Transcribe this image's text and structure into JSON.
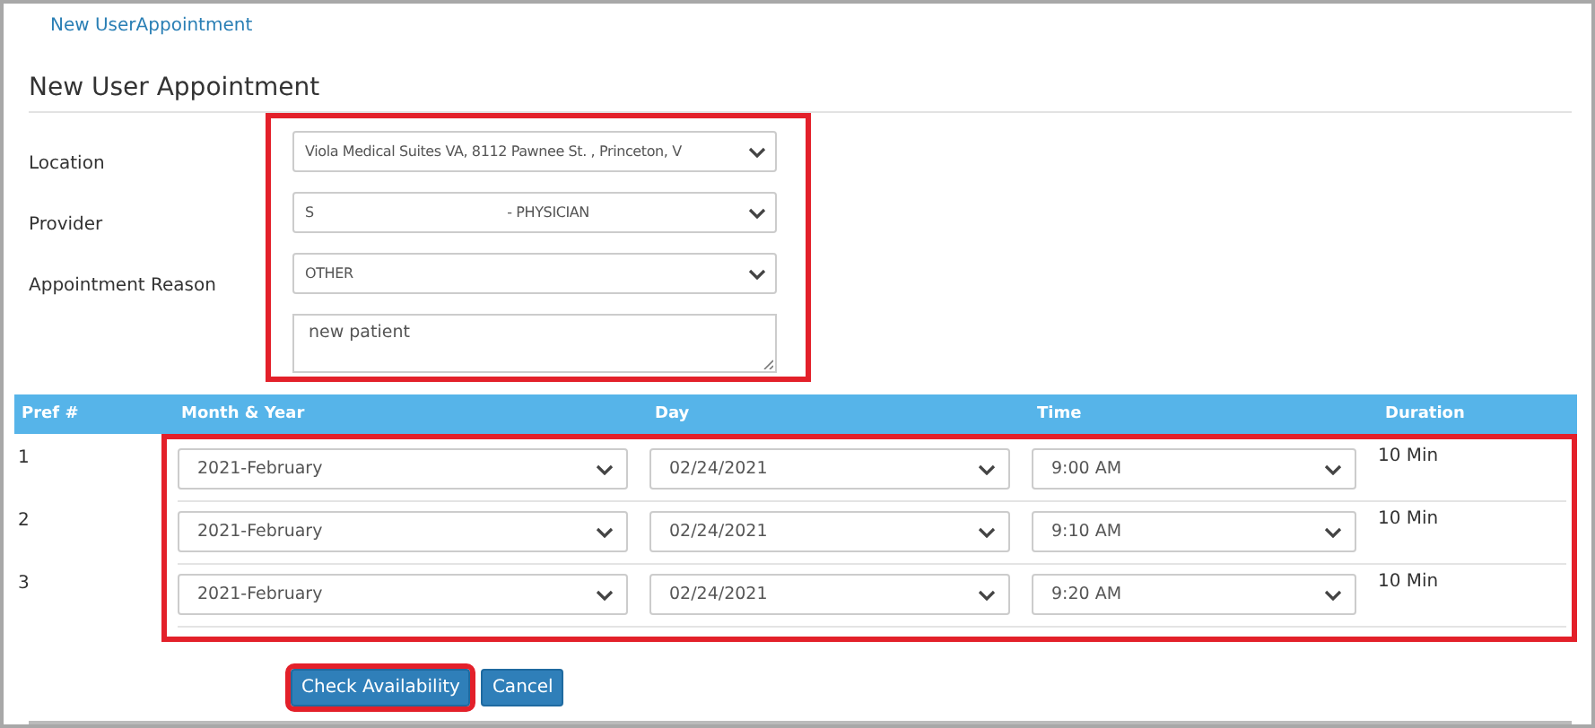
{
  "breadcrumb": "New UserAppointment",
  "title": "New User Appointment",
  "form": {
    "fields": [
      {
        "label": "Location",
        "kind": "select",
        "value": "Viola Medical Suites VA, 8112 Pawnee St. , Princeton, V"
      },
      {
        "label": "Provider",
        "kind": "select",
        "value": "S                                              - PHYSICIAN"
      },
      {
        "label": "Appointment Reason",
        "kind": "select",
        "value": "OTHER"
      },
      {
        "kind": "textarea",
        "value": "new patient"
      }
    ]
  },
  "table": {
    "columns": [
      "Pref #",
      "Month & Year",
      "Day",
      "Time",
      "Duration"
    ],
    "rows": [
      {
        "pref": "1",
        "month": "2021-February",
        "day": "02/24/2021",
        "time": "9:00 AM",
        "duration": "10 Min"
      },
      {
        "pref": "2",
        "month": "2021-February",
        "day": "02/24/2021",
        "time": "9:10 AM",
        "duration": "10 Min"
      },
      {
        "pref": "3",
        "month": "2021-February",
        "day": "02/24/2021",
        "time": "9:20 AM",
        "duration": "10 Min"
      }
    ]
  },
  "buttons": [
    {
      "label": "Check Availability",
      "highlighted": true
    },
    {
      "label": "Cancel",
      "highlighted": false
    }
  ]
}
